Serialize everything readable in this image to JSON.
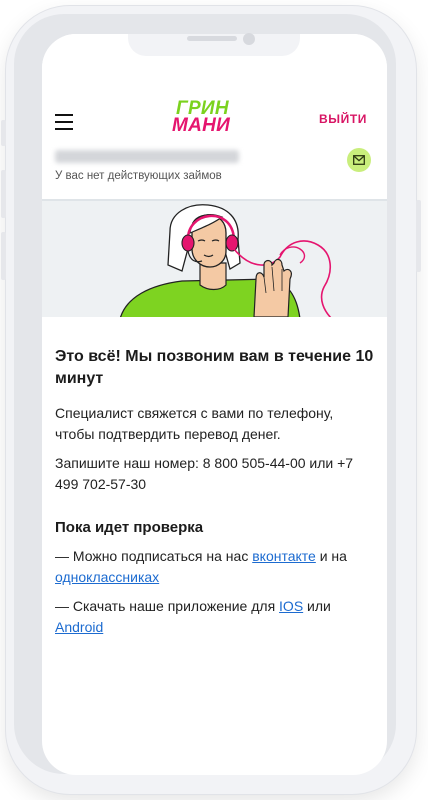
{
  "header": {
    "logo_line1": "ГРИН",
    "logo_line2": "МАНИ",
    "logout_label": "ВЫЙТИ",
    "loans_status": "У вас нет действующих займов"
  },
  "main": {
    "title": "Это всё! Мы позвоним вам в течение 10 минут",
    "paragraph1": "Специалист свяжется с вами по телефону, чтобы подтвердить перевод денег.",
    "paragraph2": "Запишите наш номер: 8 800 505-44-00 или +7 499 702-57-30",
    "subtitle": "Пока идет проверка",
    "item1_prefix": "— Можно подписаться на нас ",
    "item1_link1": "вконтакте",
    "item1_middle": " и на ",
    "item1_link2": "одноклассниках",
    "item2_prefix": "— Скачать наше приложение для ",
    "item2_link1": "IOS",
    "item2_middle": " или ",
    "item2_link2": "Android"
  },
  "icons": {
    "menu": "hamburger-menu-icon",
    "mail": "mail-icon"
  },
  "colors": {
    "brand_green": "#7bd21e",
    "brand_pink": "#e5156f",
    "logout": "#d81564",
    "link": "#1c6bd0",
    "mail_bg": "#c9ee7c"
  }
}
